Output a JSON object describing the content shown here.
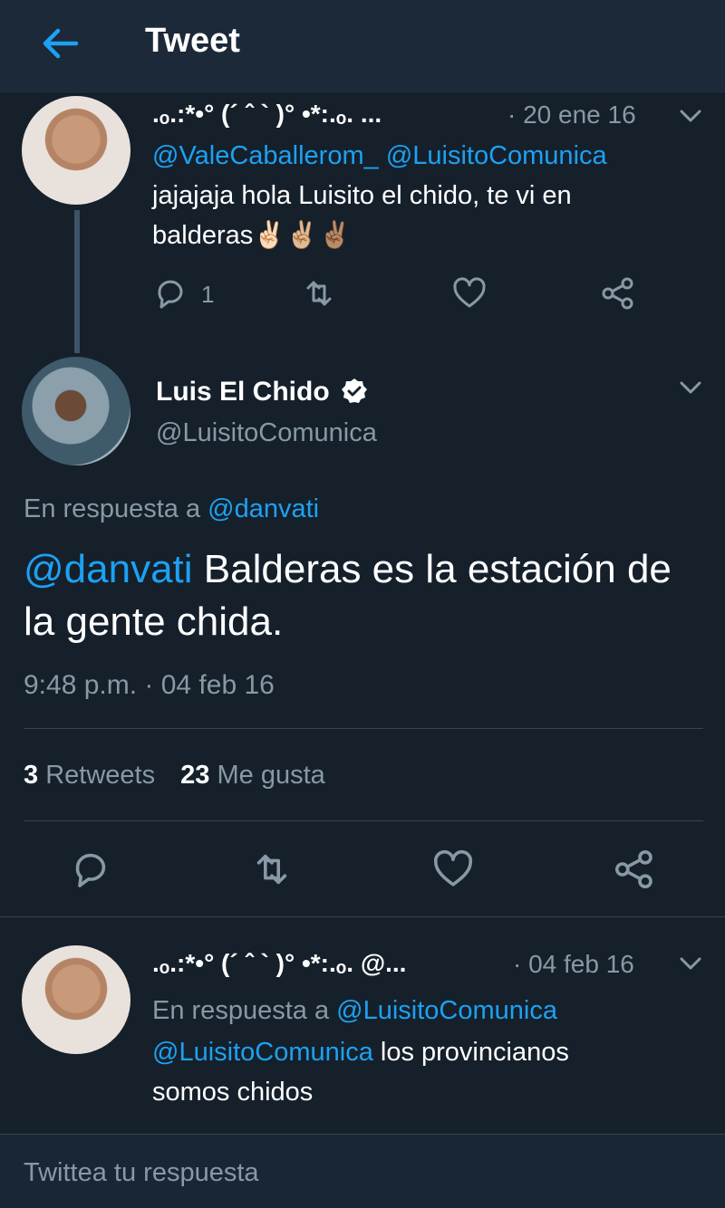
{
  "header": {
    "title": "Tweet"
  },
  "parent_tweet": {
    "display_name": ".ₒ.:*•° (´ ˆ ` )° •*:.ₒ. ...",
    "date": "· 20 ene 16",
    "mentions": [
      "@ValeCaballerom_",
      "@LuisitoComunica"
    ],
    "text_line1": "jajajaja hola Luisito el chido, te vi en",
    "text_line2": "balderas",
    "emoji": "✌🏻✌🏼✌🏽",
    "reply_count": "1"
  },
  "main_tweet": {
    "display_name": "Luis El Chido",
    "verified": true,
    "handle": "@LuisitoComunica",
    "reply_label": "En respuesta a",
    "reply_to": "@danvati",
    "mention": "@danvati",
    "text": " Balderas es la estación de la gente chida.",
    "timestamp": "9:48 p.m. · 04 feb 16",
    "retweets_count": "3",
    "retweets_label": "Retweets",
    "likes_count": "23",
    "likes_label": "Me gusta"
  },
  "reply_tweet": {
    "display_name": ".ₒ.:*•° (´ ˆ ` )° •*:.ₒ. @...",
    "date": "· 04 feb 16",
    "reply_label": "En respuesta a",
    "reply_to": "@LuisitoComunica",
    "mention": "@LuisitoComunica",
    "text_line1": " los provincianos",
    "text_line2": "somos chidos"
  },
  "compose": {
    "placeholder": "Twittea tu respuesta"
  },
  "icons": [
    "back-arrow-icon",
    "chevron-down-icon",
    "reply-icon",
    "retweet-icon",
    "like-icon",
    "share-icon",
    "verified-badge-icon"
  ],
  "colors": {
    "accent": "#1da1f2",
    "background": "#15202b",
    "header": "#1c2938",
    "muted": "#8899a6"
  }
}
